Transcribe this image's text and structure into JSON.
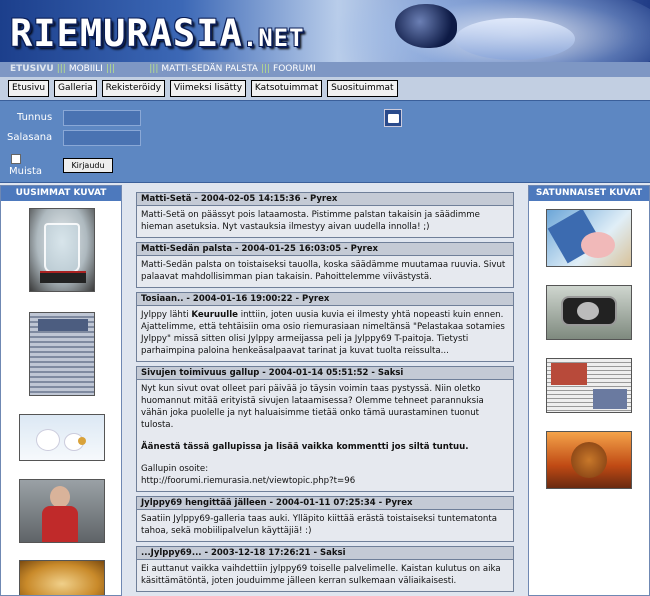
{
  "header": {
    "logo_main": "RIEMURASIA",
    "logo_suffix": ".NET"
  },
  "topnav": [
    {
      "label": "ETUSIVU",
      "selected": true
    },
    {
      "label": "MOBIILI",
      "selected": false
    },
    {
      "label": "",
      "selected": false
    },
    {
      "label": "MATTI-SEDÄN PALSTA",
      "selected": false
    },
    {
      "label": "FOORUMI",
      "selected": false
    }
  ],
  "buttons": [
    "Etusivu",
    "Galleria",
    "Rekisteröidy",
    "Viimeksi lisätty",
    "Katsotuimmat",
    "Suosituimmat"
  ],
  "login": {
    "username_label": "Tunnus",
    "password_label": "Salasana",
    "remember_label": "Muista",
    "submit_label": "Kirjaudu"
  },
  "left_column": {
    "title": "UUSIMMAT KUVAT",
    "thumbnails": [
      {
        "icon": "glass-photo"
      },
      {
        "icon": "newspaper-clipping-photo"
      },
      {
        "icon": "polar-bears-photo"
      },
      {
        "icon": "child-photo"
      },
      {
        "icon": "food-photo"
      }
    ]
  },
  "right_column": {
    "title": "SATUNNAISET KUVAT",
    "thumbnails": [
      {
        "icon": "pig-in-deckchair-photo"
      },
      {
        "icon": "camera-in-mirror-photo"
      },
      {
        "icon": "newspaper-collage-photo"
      },
      {
        "icon": "lion-painting-photo"
      }
    ]
  },
  "posts": [
    {
      "title": "Matti-Setä - 2004-02-05 14:15:36 - Pyrex",
      "body": [
        "Matti-Setä on päässyt pois lataamosta. Pistimme palstan takaisin ja säädimme hieman asetuksia. Nyt vastauksia ilmestyy aivan uudella innolla! ;)"
      ]
    },
    {
      "title": "Matti-Sedän palsta - 2004-01-25 16:03:05 - Pyrex",
      "body": [
        "Matti-Sedän palsta on toistaiseksi tauolla, koska säädämme muutamaa ruuvia. Sivut palaavat mahdollisimman pian takaisin. Pahoittelemme viivästystä."
      ]
    },
    {
      "title": "Tosiaan.. - 2004-01-16 19:00:22 - Pyrex",
      "body_pre": "Jylppy lähti ",
      "body_bold": "Keuruulle",
      "body_post": " inttiin, joten uusia kuvia ei ilmesty yhtä nopeasti kuin ennen. Ajattelimme, että tehtäisiin oma osio riemurasiaan nimeltänsä \"Pelastakaa sotamies Jylppy\" missä sitten olisi Jylppy armeijassa peli ja Jylppy69 T-paitoja. Tietysti parhaimpina paloina henkeäsalpaavat tarinat ja kuvat tuolta reissulta..."
    },
    {
      "title": "Sivujen toimivuus gallup - 2004-01-14 05:51:52 - Saksi",
      "body": [
        "Nyt kun sivut ovat olleet pari päivää jo täysin voimin taas pystyssä. Niin oletko huomannut mitää erityistä sivujen lataamisessa? Olemme tehneet parannuksia vähän joka puolelle ja nyt haluaisimme tietää onko tämä uurastaminen tuonut tulosta.",
        "Äänestä tässä gallupissa ja lisää vaikka kommentti jos siltä tuntuu.",
        "Gallupin osoite:\nhttp://foorumi.riemurasia.net/viewtopic.php?t=96"
      ]
    },
    {
      "title": "Jylppy69 hengittää jälleen - 2004-01-11 07:25:34 - Pyrex",
      "body": [
        "Saatiin Jylppy69-galleria taas auki. Ylläpito kiittää erästä toistaiseksi tuntematonta tahoa, sekä mobiilipalvelun käyttäjiä! :)"
      ]
    },
    {
      "title": "...Jylppy69... - 2003-12-18 17:26:21 - Saksi",
      "body": [
        "Ei auttanut vaikka vaihdettiin jylppy69 toiselle palvelimelle. Kaistan kulutus on aika käsittämätöntä, joten jouduimme jälleen kerran sulkemaan väliaikaisesti."
      ]
    }
  ]
}
